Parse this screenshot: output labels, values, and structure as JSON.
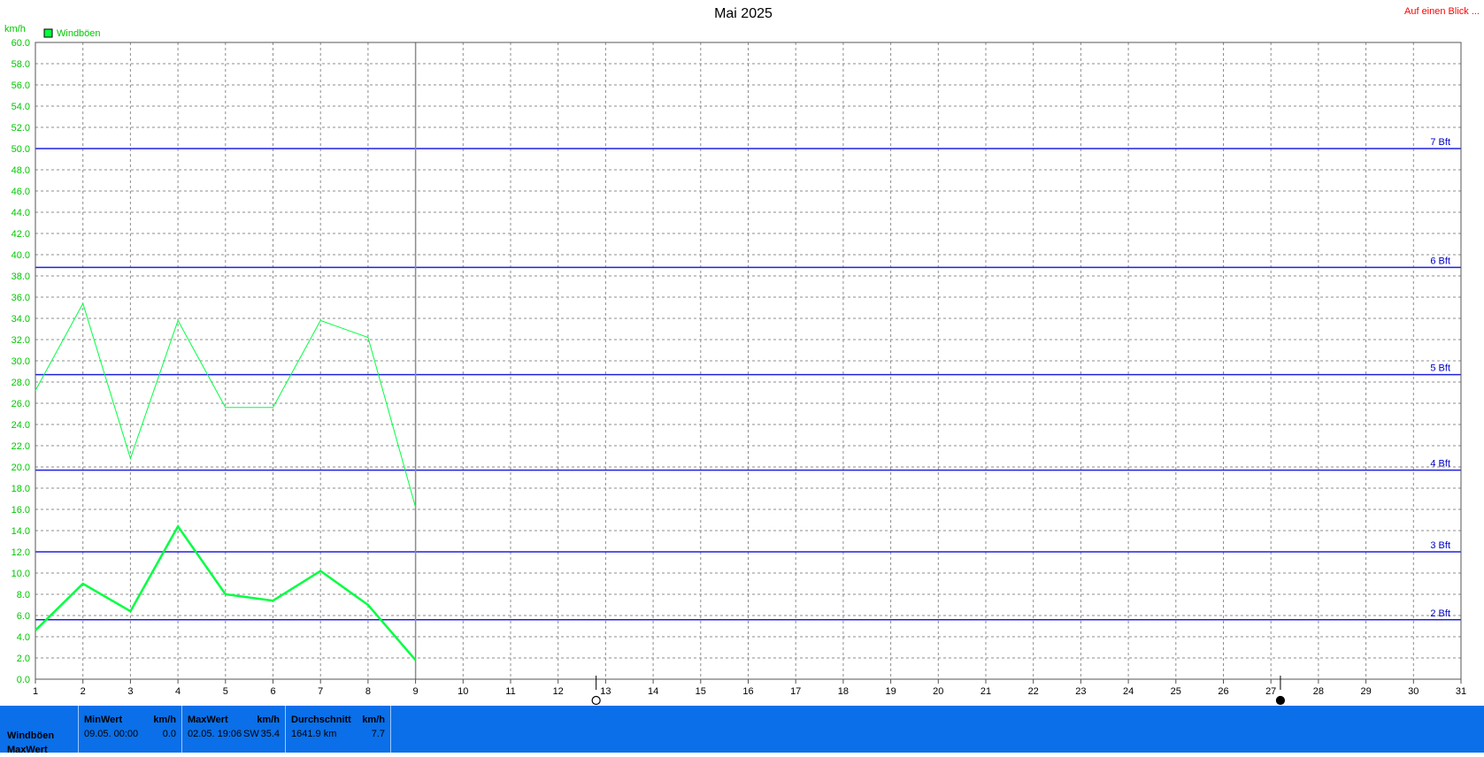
{
  "chart_data": {
    "type": "line",
    "title": "Mai 2025",
    "ylabel": "km/h",
    "ylim": [
      0,
      60
    ],
    "yticks": [
      "0.0",
      "2.0",
      "4.0",
      "6.0",
      "8.0",
      "10.0",
      "12.0",
      "14.0",
      "16.0",
      "18.0",
      "20.0",
      "22.0",
      "24.0",
      "26.0",
      "28.0",
      "30.0",
      "32.0",
      "34.0",
      "36.0",
      "38.0",
      "40.0",
      "42.0",
      "44.0",
      "46.0",
      "48.0",
      "50.0",
      "52.0",
      "54.0",
      "56.0",
      "58.0",
      "60.0"
    ],
    "xlim": [
      1,
      31
    ],
    "xticks": [
      "1",
      "2",
      "3",
      "4",
      "5",
      "6",
      "7",
      "8",
      "9",
      "10",
      "11",
      "12",
      "13",
      "14",
      "15",
      "16",
      "17",
      "18",
      "19",
      "20",
      "21",
      "22",
      "23",
      "24",
      "25",
      "26",
      "27",
      "28",
      "29",
      "30",
      "31"
    ],
    "grid": true,
    "legend": [
      {
        "label": "Windböen",
        "color": "#00ff40",
        "position": "top-left"
      }
    ],
    "series": [
      {
        "name": "Windböen",
        "role": "max",
        "color": "#00ff40",
        "width": 1,
        "x": [
          1,
          2,
          3,
          4,
          5,
          6,
          7,
          8,
          9
        ],
        "y": [
          27.2,
          35.4,
          20.8,
          33.8,
          25.6,
          25.6,
          33.8,
          32.2,
          16.2
        ]
      },
      {
        "name": "Windböen",
        "role": "mean",
        "color": "#00ff40",
        "width": 2.5,
        "x": [
          1,
          2,
          3,
          4,
          5,
          6,
          7,
          8,
          9
        ],
        "y": [
          4.6,
          9.0,
          6.4,
          14.4,
          8.0,
          7.4,
          10.2,
          7.0,
          1.8
        ]
      }
    ],
    "reference_lines": [
      {
        "label": "2 Bft",
        "y": 5.6
      },
      {
        "label": "3 Bft",
        "y": 12.0
      },
      {
        "label": "4 Bft",
        "y": 19.7
      },
      {
        "label": "5 Bft",
        "y": 28.7
      },
      {
        "label": "6 Bft",
        "y": 38.8
      },
      {
        "label": "7 Bft",
        "y": 50.0
      }
    ],
    "current_day": 9,
    "moon_markers": [
      {
        "x": 12.8,
        "icon": "full-moon-icon"
      },
      {
        "x": 27.2,
        "icon": "new-moon-icon"
      }
    ]
  },
  "top_link": "Auf einen Blick ...",
  "stats": {
    "row_label_1": "Windböen",
    "row_label_2": "MaxWert",
    "min": {
      "header": "MinWert",
      "unit": "km/h",
      "date": "09.05.  00:00",
      "value": "0.0"
    },
    "max": {
      "header": "MaxWert",
      "unit": "km/h",
      "date": "02.05.  19:06",
      "dir": "SW",
      "value": "35.4"
    },
    "avg": {
      "header": "Durchschnitt",
      "unit": "km/h",
      "total": "1641.9 km",
      "value": "7.7"
    }
  },
  "colors": {
    "series": "#00ff40",
    "axis_text": "#00c800",
    "bft": "#0000c0",
    "stats_bg": "#0a6fe8",
    "link": "#ff0000"
  }
}
